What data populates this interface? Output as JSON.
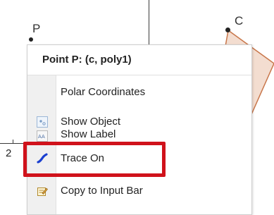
{
  "canvas": {
    "point_p_label": "P",
    "point_c_label": "C",
    "x_tick_label": "2"
  },
  "context_menu": {
    "title": "Point P: (c, poly1)",
    "items": [
      {
        "label": "Polar Coordinates",
        "icon": "none"
      },
      {
        "label": "Show Object",
        "icon": "show-object-icon"
      },
      {
        "label": "Show Label",
        "icon": "show-label-icon"
      },
      {
        "label": "Trace On",
        "icon": "trace-icon"
      },
      {
        "label": "Copy to Input Bar",
        "icon": "pencil-note-icon"
      }
    ]
  },
  "colors": {
    "highlight": "#d0121b",
    "polygon_fill": "#f3ddd0",
    "polygon_stroke": "#c8764a",
    "trace_icon": "#1a3fd0"
  }
}
